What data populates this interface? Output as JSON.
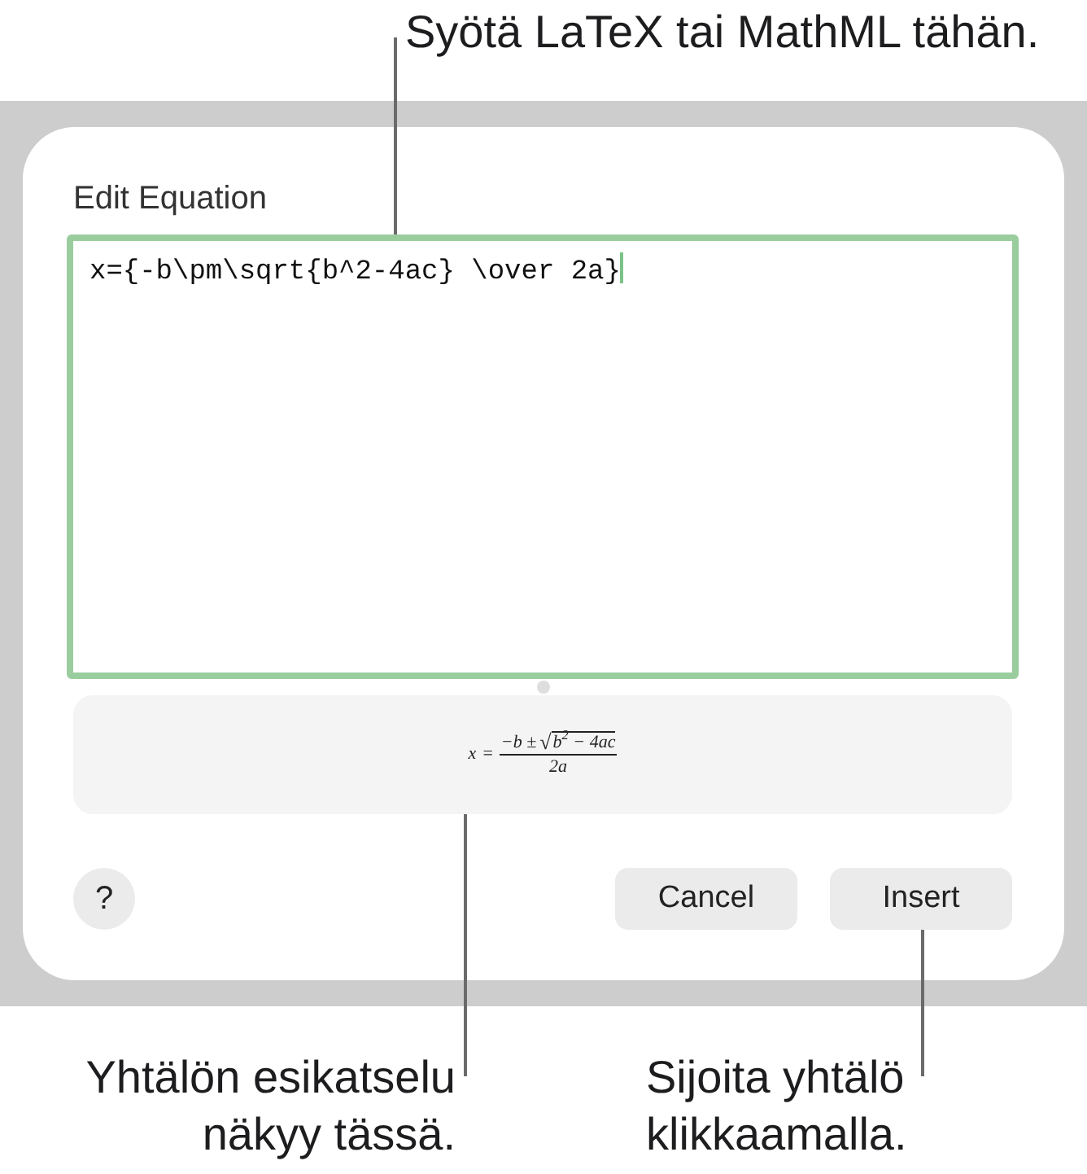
{
  "callouts": {
    "editor": {
      "lines": [
        "Syötä LaTeX tai MathML tähän."
      ]
    },
    "preview": {
      "lines": [
        "Yhtälön esikatselu",
        "näkyy tässä."
      ]
    },
    "insert": {
      "lines": [
        "Sijoita yhtälö",
        "klikkaamalla."
      ]
    }
  },
  "dialog": {
    "title": "Edit Equation",
    "editor": {
      "value": "x={-b\\pm\\sqrt{b^2-4ac} \\over 2a}",
      "focused": true
    },
    "preview": {
      "lhs": "x",
      "relation": "=",
      "numerator": "−b ±",
      "radical": "√",
      "radicand": "b$^{2}$ − 4ac",
      "denominator": "2a"
    },
    "help_button": "?",
    "buttons": [
      {
        "label": "Cancel"
      },
      {
        "label": "Insert"
      }
    ]
  }
}
